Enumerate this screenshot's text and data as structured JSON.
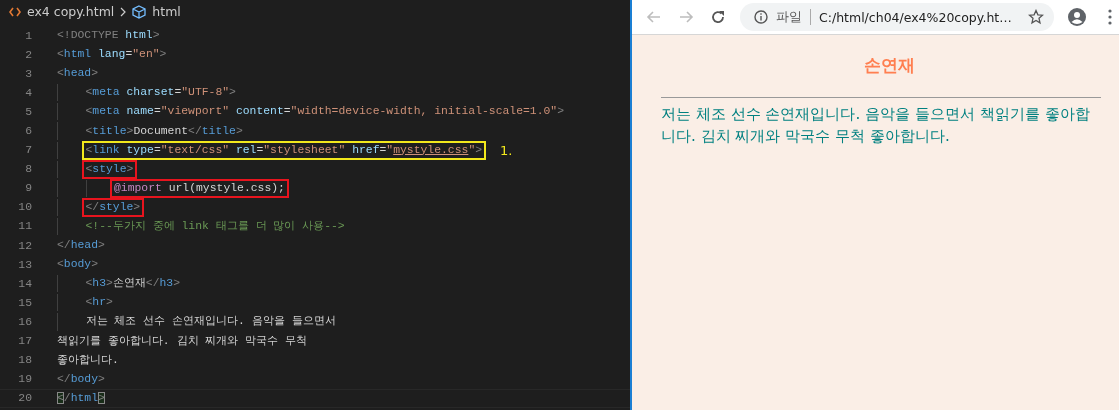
{
  "editor": {
    "breadcrumb": {
      "file": "ex4 copy.html",
      "symbol": "html"
    },
    "lines": [
      {
        "number": "1",
        "indented": false,
        "tokens": [
          {
            "kind": "punct",
            "text": "<!DOCTYPE"
          },
          {
            "kind": "attr",
            "text": " html"
          },
          {
            "kind": "punct",
            "text": ">"
          }
        ]
      },
      {
        "number": "2",
        "indented": false,
        "tokens": [
          {
            "kind": "punct",
            "text": "<"
          },
          {
            "kind": "tag",
            "text": "html"
          },
          {
            "kind": "attr",
            "text": " lang"
          },
          {
            "kind": "text",
            "text": "="
          },
          {
            "kind": "string",
            "text": "\"en\""
          },
          {
            "kind": "punct",
            "text": ">"
          }
        ]
      },
      {
        "number": "3",
        "indented": false,
        "tokens": [
          {
            "kind": "punct",
            "text": "<"
          },
          {
            "kind": "tag",
            "text": "head"
          },
          {
            "kind": "punct",
            "text": ">"
          }
        ]
      },
      {
        "number": "4",
        "indented": true,
        "tokens": [
          {
            "kind": "punct",
            "text": "<"
          },
          {
            "kind": "tag",
            "text": "meta"
          },
          {
            "kind": "attr",
            "text": " charset"
          },
          {
            "kind": "text",
            "text": "="
          },
          {
            "kind": "string",
            "text": "\"UTF-8\""
          },
          {
            "kind": "punct",
            "text": ">"
          }
        ]
      },
      {
        "number": "5",
        "indented": true,
        "tokens": [
          {
            "kind": "punct",
            "text": "<"
          },
          {
            "kind": "tag",
            "text": "meta"
          },
          {
            "kind": "attr",
            "text": " name"
          },
          {
            "kind": "text",
            "text": "="
          },
          {
            "kind": "string",
            "text": "\"viewport\""
          },
          {
            "kind": "attr",
            "text": " content"
          },
          {
            "kind": "text",
            "text": "="
          },
          {
            "kind": "string",
            "text": "\"width=device-width, initial-scale=1.0\""
          },
          {
            "kind": "punct",
            "text": ">"
          }
        ]
      },
      {
        "number": "6",
        "indented": true,
        "tokens": [
          {
            "kind": "punct",
            "text": "<"
          },
          {
            "kind": "tag",
            "text": "title"
          },
          {
            "kind": "punct",
            "text": ">"
          },
          {
            "kind": "text",
            "text": "Document"
          },
          {
            "kind": "punct",
            "text": "</"
          },
          {
            "kind": "tag",
            "text": "title"
          },
          {
            "kind": "punct",
            "text": ">"
          }
        ]
      },
      {
        "number": "7",
        "indented": true,
        "color": "#f2e81c",
        "note": "1.",
        "tokens": [
          {
            "kind": "punct",
            "text": "<"
          },
          {
            "kind": "tag",
            "text": "link"
          },
          {
            "kind": "attr",
            "text": " type"
          },
          {
            "kind": "text",
            "text": "="
          },
          {
            "kind": "string",
            "text": "\"text/css\""
          },
          {
            "kind": "attr",
            "text": " rel"
          },
          {
            "kind": "text",
            "text": "="
          },
          {
            "kind": "string",
            "text": "\"stylesheet\""
          },
          {
            "kind": "attr",
            "text": " href"
          },
          {
            "kind": "text",
            "text": "="
          },
          {
            "kind": "string",
            "text": "\""
          },
          {
            "kind": "link",
            "text": "mystyle.css"
          },
          {
            "kind": "string",
            "text": "\""
          },
          {
            "kind": "punct",
            "text": ">"
          }
        ]
      },
      {
        "number": "8",
        "indented": true,
        "color": "#e8141e",
        "tokens": [
          {
            "kind": "punct",
            "text": "<"
          },
          {
            "kind": "tag",
            "text": "style"
          },
          {
            "kind": "punct",
            "text": ">"
          }
        ]
      },
      {
        "number": "9",
        "indented": true,
        "nested": true,
        "color": "#e8141e",
        "tokens": [
          {
            "kind": "keyword",
            "text": "@import"
          },
          {
            "kind": "text",
            "text": " url(mystyle.css);"
          }
        ]
      },
      {
        "number": "10",
        "indented": true,
        "color": "#e8141e",
        "tokens": [
          {
            "kind": "punct",
            "text": "</"
          },
          {
            "kind": "tag",
            "text": "style"
          },
          {
            "kind": "punct",
            "text": ">"
          }
        ]
      },
      {
        "number": "11",
        "indented": true,
        "tokens": [
          {
            "kind": "comment",
            "text": "<!--두가지 중에 link 태그를 더 많이 사용-->"
          }
        ]
      },
      {
        "number": "12",
        "indented": false,
        "tokens": [
          {
            "kind": "punct",
            "text": "</"
          },
          {
            "kind": "tag",
            "text": "head"
          },
          {
            "kind": "punct",
            "text": ">"
          }
        ]
      },
      {
        "number": "13",
        "indented": false,
        "tokens": [
          {
            "kind": "punct",
            "text": "<"
          },
          {
            "kind": "tag",
            "text": "body"
          },
          {
            "kind": "punct",
            "text": ">"
          }
        ]
      },
      {
        "number": "14",
        "indented": true,
        "tokens": [
          {
            "kind": "punct",
            "text": "<"
          },
          {
            "kind": "tag",
            "text": "h3"
          },
          {
            "kind": "punct",
            "text": ">"
          },
          {
            "kind": "text",
            "text": "손연재"
          },
          {
            "kind": "punct",
            "text": "</"
          },
          {
            "kind": "tag",
            "text": "h3"
          },
          {
            "kind": "punct",
            "text": ">"
          }
        ]
      },
      {
        "number": "15",
        "indented": true,
        "tokens": [
          {
            "kind": "punct",
            "text": "<"
          },
          {
            "kind": "tag",
            "text": "hr"
          },
          {
            "kind": "punct",
            "text": ">"
          }
        ]
      },
      {
        "number": "16",
        "indented": true,
        "tokens": [
          {
            "kind": "text",
            "text": "저는 체조 선수 손연재입니다. 음악을 들으면서"
          }
        ]
      },
      {
        "number": "17",
        "indented": false,
        "tokens": [
          {
            "kind": "text",
            "text": "책읽기를 좋아합니다. 김치 찌개와 막국수 무척"
          }
        ]
      },
      {
        "number": "18",
        "indented": false,
        "tokens": [
          {
            "kind": "text",
            "text": "좋아합니다."
          }
        ]
      },
      {
        "number": "19",
        "indented": false,
        "tokens": [
          {
            "kind": "punct",
            "text": "</"
          },
          {
            "kind": "tag",
            "text": "body"
          },
          {
            "kind": "punct",
            "text": ">"
          }
        ]
      },
      {
        "number": "20",
        "indented": false,
        "current": true,
        "tokens": [
          {
            "kind": "match",
            "text": "<"
          },
          {
            "kind": "punct",
            "text": "/"
          },
          {
            "kind": "tag",
            "text": "html"
          },
          {
            "kind": "match",
            "text": ">"
          }
        ]
      }
    ]
  },
  "browser": {
    "back": {
      "disabled": true
    },
    "forward": {
      "disabled": true
    },
    "address": {
      "scheme_label": "파일",
      "url": "C:/html/ch04/ex4%20copy.ht…"
    },
    "page": {
      "heading": "손연재",
      "paragraph": "저는 체조 선수 손연재입니다. 음악을 들으면서 책읽기를 좋아합니다. 김치 찌개와 막국수 무척 좋아합니다."
    }
  }
}
